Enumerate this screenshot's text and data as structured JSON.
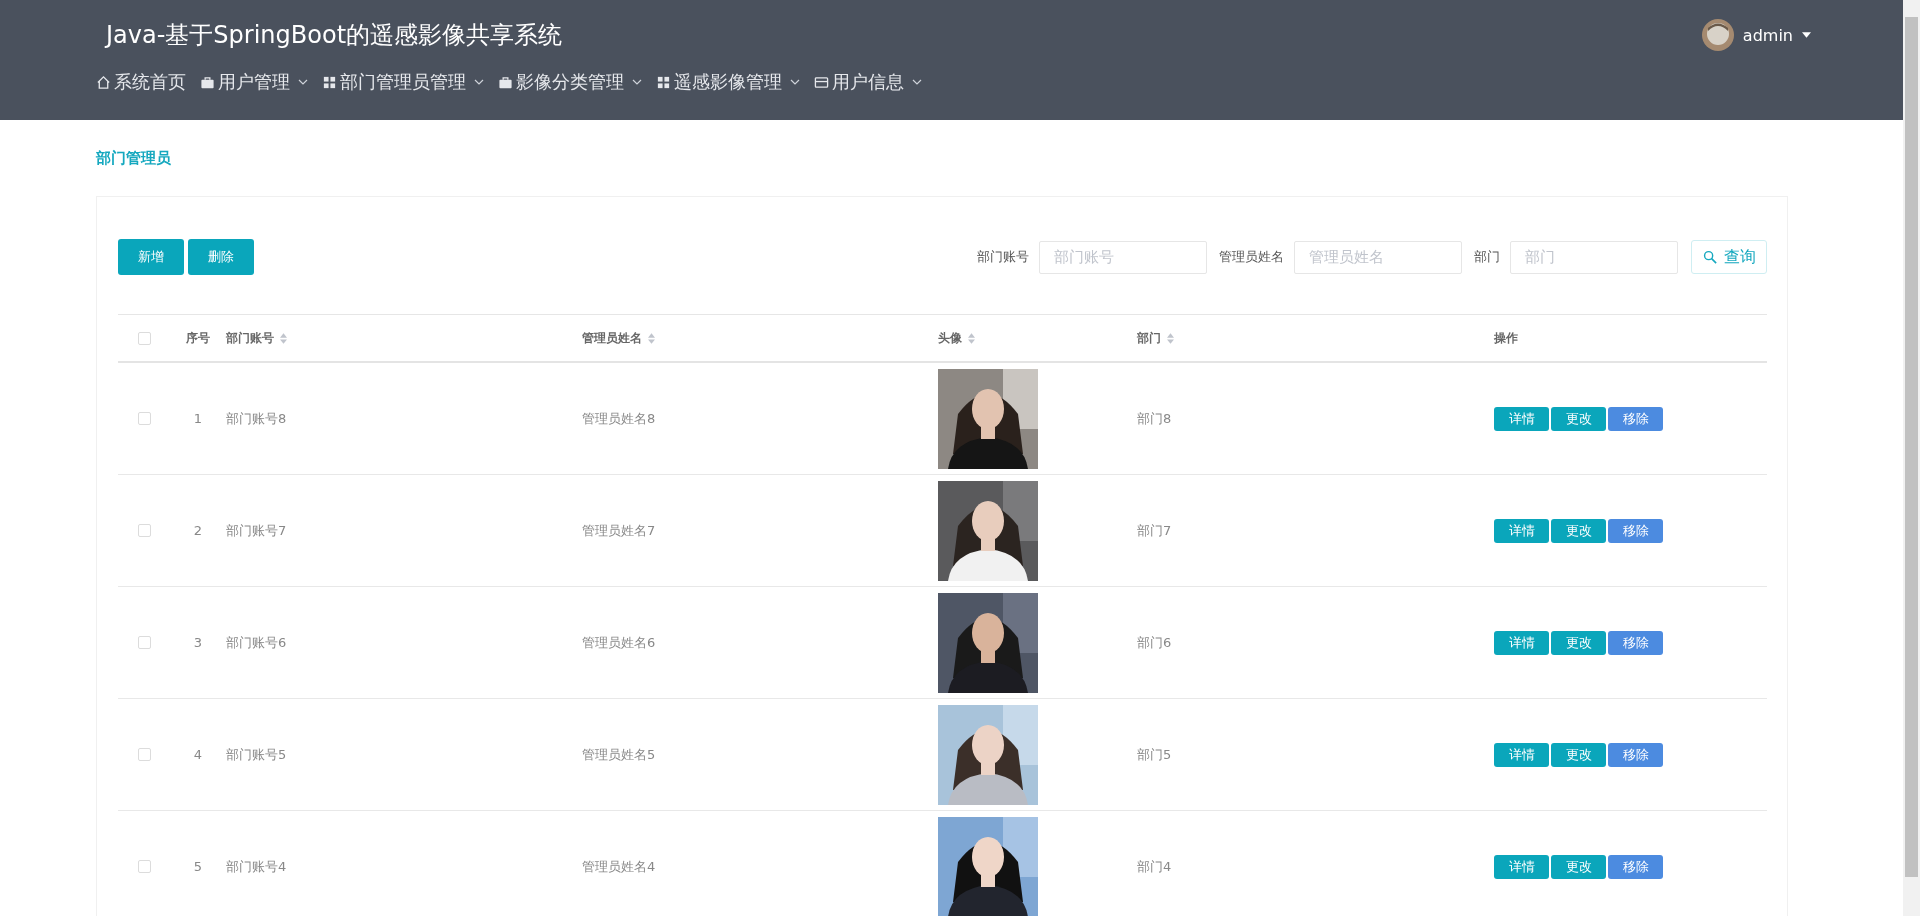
{
  "header": {
    "title": "Java-基于SpringBoot的遥感影像共享系统",
    "user": "admin",
    "nav": [
      {
        "label": "系统首页",
        "dropdown": false
      },
      {
        "label": "用户管理",
        "dropdown": true
      },
      {
        "label": "部门管理员管理",
        "dropdown": true
      },
      {
        "label": "影像分类管理",
        "dropdown": true
      },
      {
        "label": "遥感影像管理",
        "dropdown": true
      },
      {
        "label": "用户信息",
        "dropdown": true
      }
    ]
  },
  "breadcrumb": "部门管理员",
  "toolbar": {
    "buttons": [
      {
        "label": "新增"
      },
      {
        "label": "删除"
      }
    ],
    "filters": [
      {
        "label": "部门账号",
        "placeholder": "部门账号"
      },
      {
        "label": "管理员姓名",
        "placeholder": "管理员姓名"
      },
      {
        "label": "部门",
        "placeholder": "部门"
      }
    ],
    "search": "查询"
  },
  "table": {
    "select_all_checked": false,
    "columns": [
      {
        "label": "序号",
        "sortable": false
      },
      {
        "label": "部门账号",
        "sortable": true
      },
      {
        "label": "管理员姓名",
        "sortable": true
      },
      {
        "label": "头像",
        "sortable": true
      },
      {
        "label": "部门",
        "sortable": true
      },
      {
        "label": "操作",
        "sortable": false
      }
    ],
    "rows": [
      {
        "checked": false,
        "index": "1",
        "account": "部门账号8",
        "name": "管理员姓名8",
        "dept": "部门8",
        "actions": [
          "详情",
          "更改",
          "移除"
        ]
      },
      {
        "checked": false,
        "index": "2",
        "account": "部门账号7",
        "name": "管理员姓名7",
        "dept": "部门7",
        "actions": [
          "详情",
          "更改",
          "移除"
        ]
      },
      {
        "checked": false,
        "index": "3",
        "account": "部门账号6",
        "name": "管理员姓名6",
        "dept": "部门6",
        "actions": [
          "详情",
          "更改",
          "移除"
        ]
      },
      {
        "checked": false,
        "index": "4",
        "account": "部门账号5",
        "name": "管理员姓名5",
        "dept": "部门5",
        "actions": [
          "详情",
          "更改",
          "移除"
        ]
      },
      {
        "checked": false,
        "index": "5",
        "account": "部门账号4",
        "name": "管理员姓名4",
        "dept": "部门4",
        "actions": [
          "详情",
          "更改",
          "移除"
        ]
      }
    ]
  }
}
